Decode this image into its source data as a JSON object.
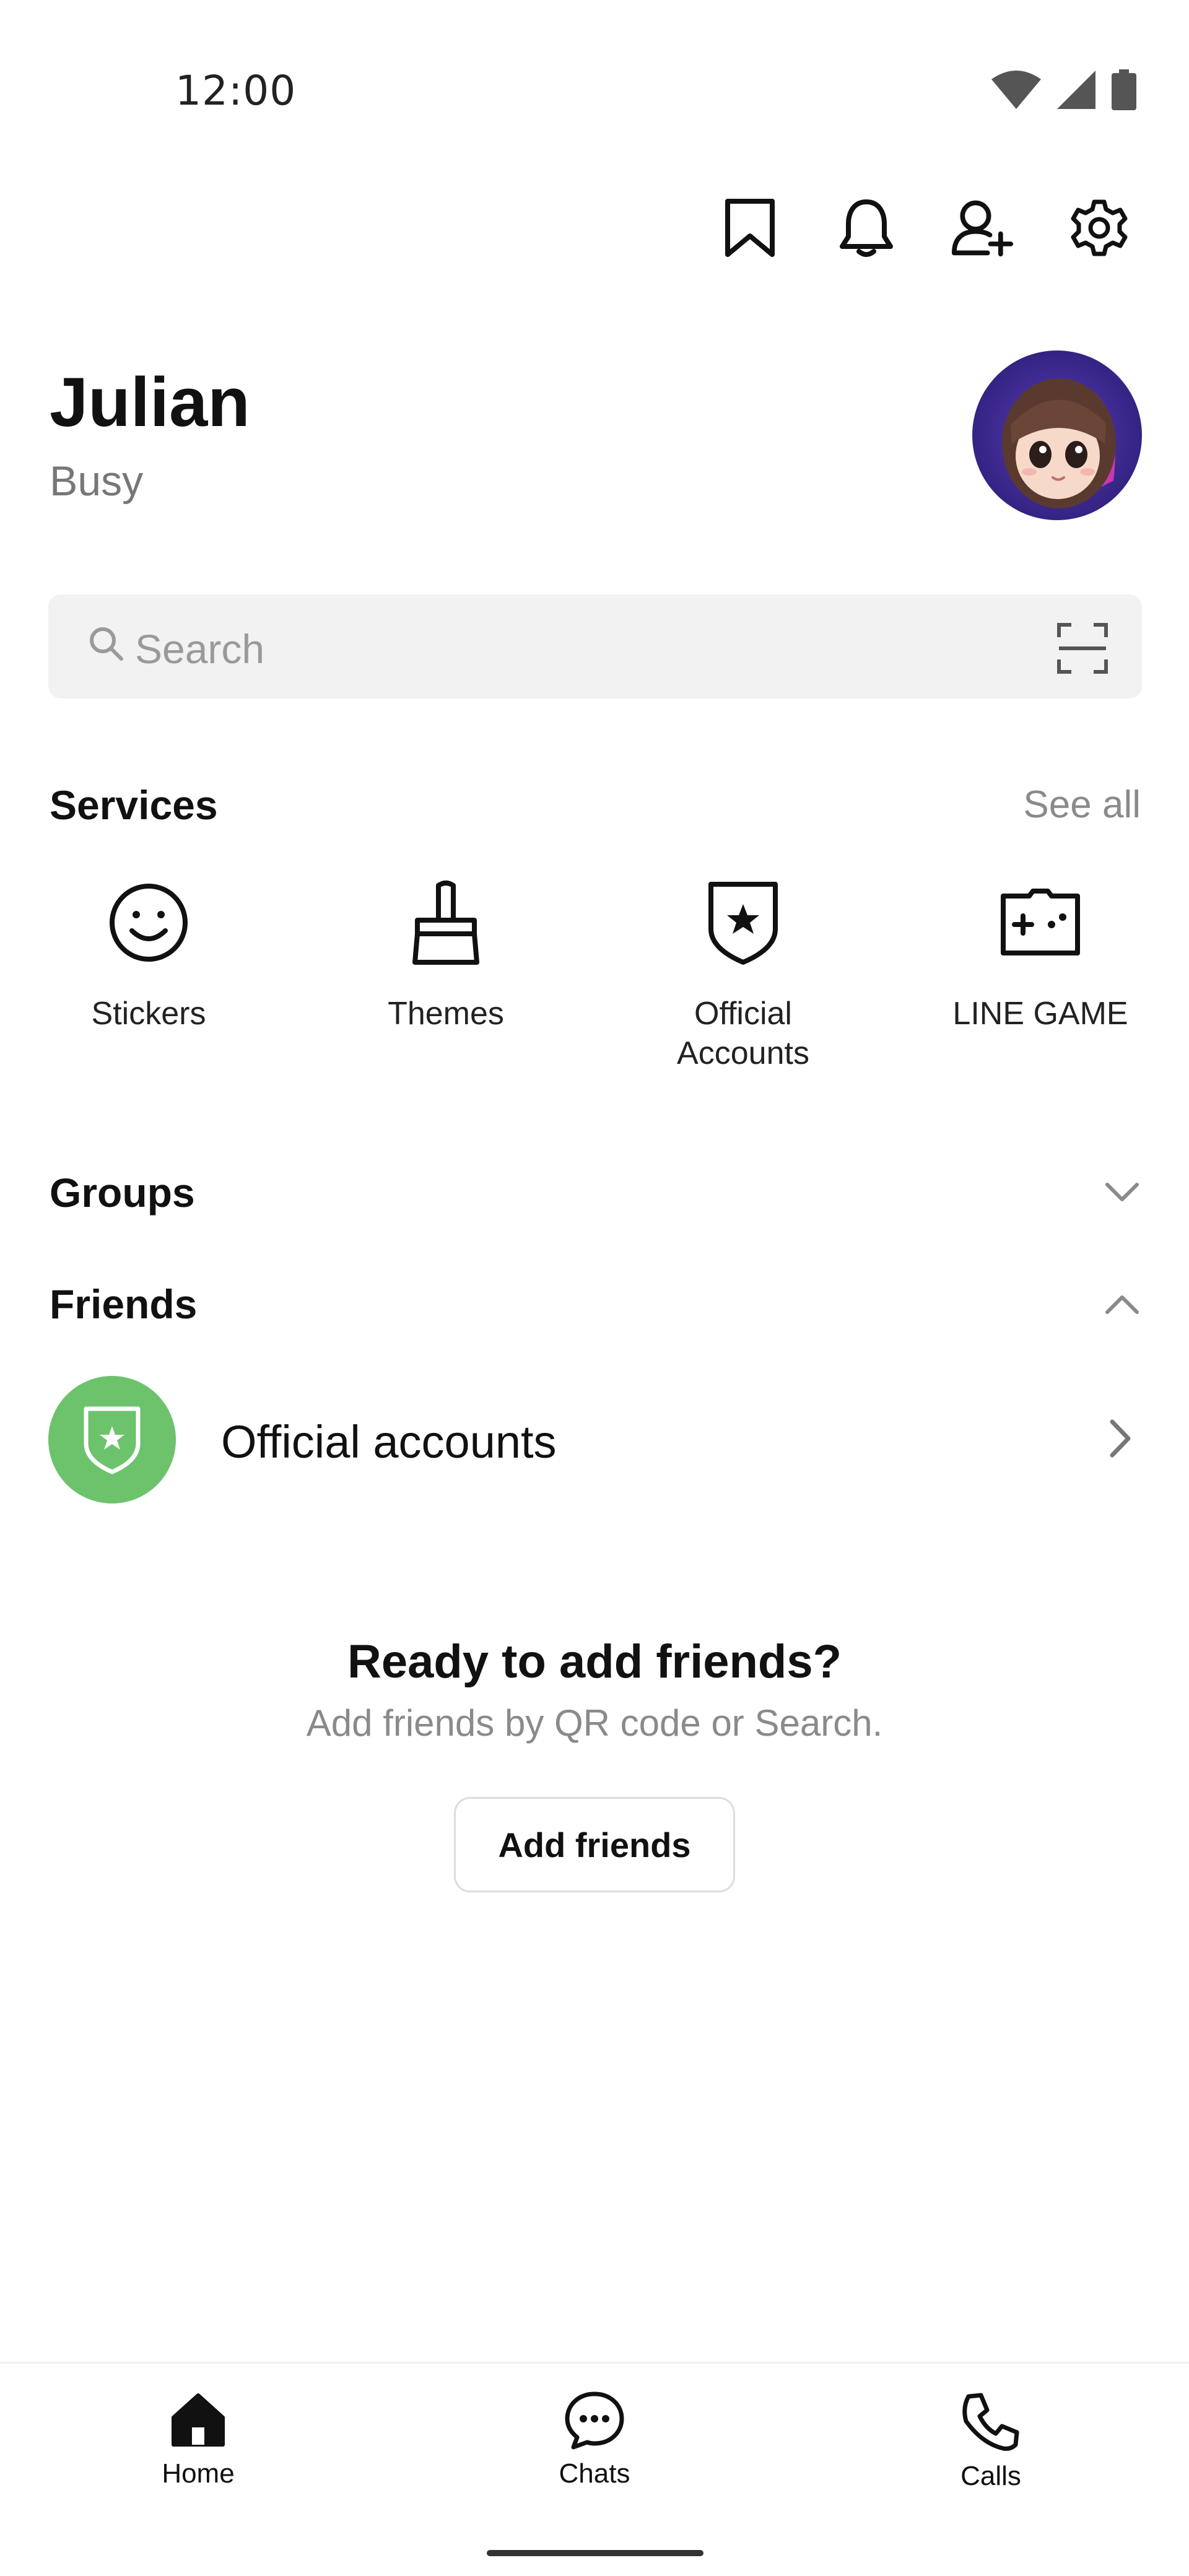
{
  "status_bar": {
    "time": "12:00"
  },
  "top_actions": [
    "bookmark-icon",
    "bell-icon",
    "add-friend-icon",
    "gear-icon"
  ],
  "profile": {
    "name": "Julian",
    "status": "Busy"
  },
  "search": {
    "placeholder": "Search"
  },
  "services": {
    "title": "Services",
    "see_all": "See all",
    "items": [
      {
        "label": "Stickers",
        "icon": "smiley-icon"
      },
      {
        "label": "Themes",
        "icon": "brush-icon"
      },
      {
        "label": "Official\nAccounts",
        "icon": "shield-star-icon"
      },
      {
        "label": "LINE GAME",
        "icon": "gamepad-icon"
      }
    ]
  },
  "groups": {
    "title": "Groups",
    "expanded": false
  },
  "friends": {
    "title": "Friends",
    "expanded": true
  },
  "official_accounts_row": {
    "label": "Official accounts",
    "accent": "#6cc36c"
  },
  "empty_state": {
    "title": "Ready to add friends?",
    "subtitle": "Add friends by QR code or Search.",
    "button": "Add friends"
  },
  "bottom_nav": [
    {
      "label": "Home",
      "icon": "home-icon",
      "active": true
    },
    {
      "label": "Chats",
      "icon": "chat-icon",
      "active": false
    },
    {
      "label": "Calls",
      "icon": "phone-icon",
      "active": false
    }
  ]
}
